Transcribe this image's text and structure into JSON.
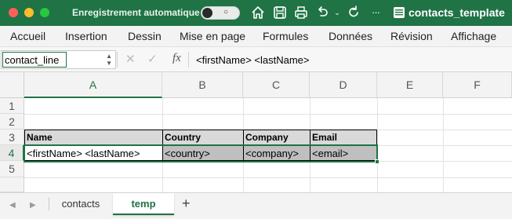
{
  "titlebar": {
    "autosave_label": "Enregistrement automatique",
    "autosave_state": "○",
    "document_title": "contacts_template",
    "accent_color": "#1f7345"
  },
  "ribbon": {
    "tabs": [
      "Accueil",
      "Insertion",
      "Dessin",
      "Mise en page",
      "Formules",
      "Données",
      "Révision",
      "Affichage"
    ]
  },
  "formula_bar": {
    "name_box_value": "contact_line",
    "fx_label": "fx",
    "formula": "<firstName> <lastName>"
  },
  "grid": {
    "columns": [
      "A",
      "B",
      "C",
      "D",
      "E",
      "F"
    ],
    "rows": [
      "1",
      "2",
      "3",
      "4",
      "5"
    ],
    "selected_row": "4",
    "selected_column": "A",
    "headers": [
      "Name",
      "Country",
      "Company",
      "Email"
    ],
    "data": [
      "<firstName> <lastName>",
      "<country>",
      "<company>",
      "<email>"
    ]
  },
  "sheet_tabs": {
    "tabs": [
      "contacts",
      "temp"
    ],
    "active": "temp",
    "add_label": "+"
  }
}
